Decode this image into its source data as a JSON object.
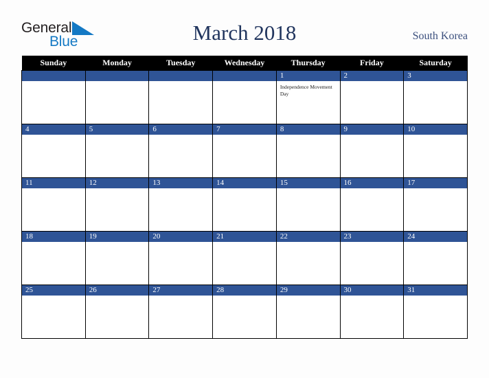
{
  "brand": {
    "name_part1": "General",
    "name_part2": "Blue",
    "triangle_icon": "triangle-icon",
    "colors": {
      "general_text": "#231f20",
      "blue_text": "#1479c4",
      "triangle": "#1479c4"
    }
  },
  "header": {
    "title": "March 2018",
    "region": "South Korea",
    "title_color": "#21355e",
    "region_color": "#3b4f7d"
  },
  "calendar": {
    "month": "March",
    "year": "2018",
    "header_bg": "#000000",
    "day_bar_bg": "#2f5496",
    "weekdays": [
      "Sunday",
      "Monday",
      "Tuesday",
      "Wednesday",
      "Thursday",
      "Friday",
      "Saturday"
    ],
    "weeks": [
      [
        {
          "day": "",
          "events": []
        },
        {
          "day": "",
          "events": []
        },
        {
          "day": "",
          "events": []
        },
        {
          "day": "",
          "events": []
        },
        {
          "day": "1",
          "events": [
            "Independence Movement Day"
          ]
        },
        {
          "day": "2",
          "events": []
        },
        {
          "day": "3",
          "events": []
        }
      ],
      [
        {
          "day": "4",
          "events": []
        },
        {
          "day": "5",
          "events": []
        },
        {
          "day": "6",
          "events": []
        },
        {
          "day": "7",
          "events": []
        },
        {
          "day": "8",
          "events": []
        },
        {
          "day": "9",
          "events": []
        },
        {
          "day": "10",
          "events": []
        }
      ],
      [
        {
          "day": "11",
          "events": []
        },
        {
          "day": "12",
          "events": []
        },
        {
          "day": "13",
          "events": []
        },
        {
          "day": "14",
          "events": []
        },
        {
          "day": "15",
          "events": []
        },
        {
          "day": "16",
          "events": []
        },
        {
          "day": "17",
          "events": []
        }
      ],
      [
        {
          "day": "18",
          "events": []
        },
        {
          "day": "19",
          "events": []
        },
        {
          "day": "20",
          "events": []
        },
        {
          "day": "21",
          "events": []
        },
        {
          "day": "22",
          "events": []
        },
        {
          "day": "23",
          "events": []
        },
        {
          "day": "24",
          "events": []
        }
      ],
      [
        {
          "day": "25",
          "events": []
        },
        {
          "day": "26",
          "events": []
        },
        {
          "day": "27",
          "events": []
        },
        {
          "day": "28",
          "events": []
        },
        {
          "day": "29",
          "events": []
        },
        {
          "day": "30",
          "events": []
        },
        {
          "day": "31",
          "events": []
        }
      ]
    ]
  }
}
